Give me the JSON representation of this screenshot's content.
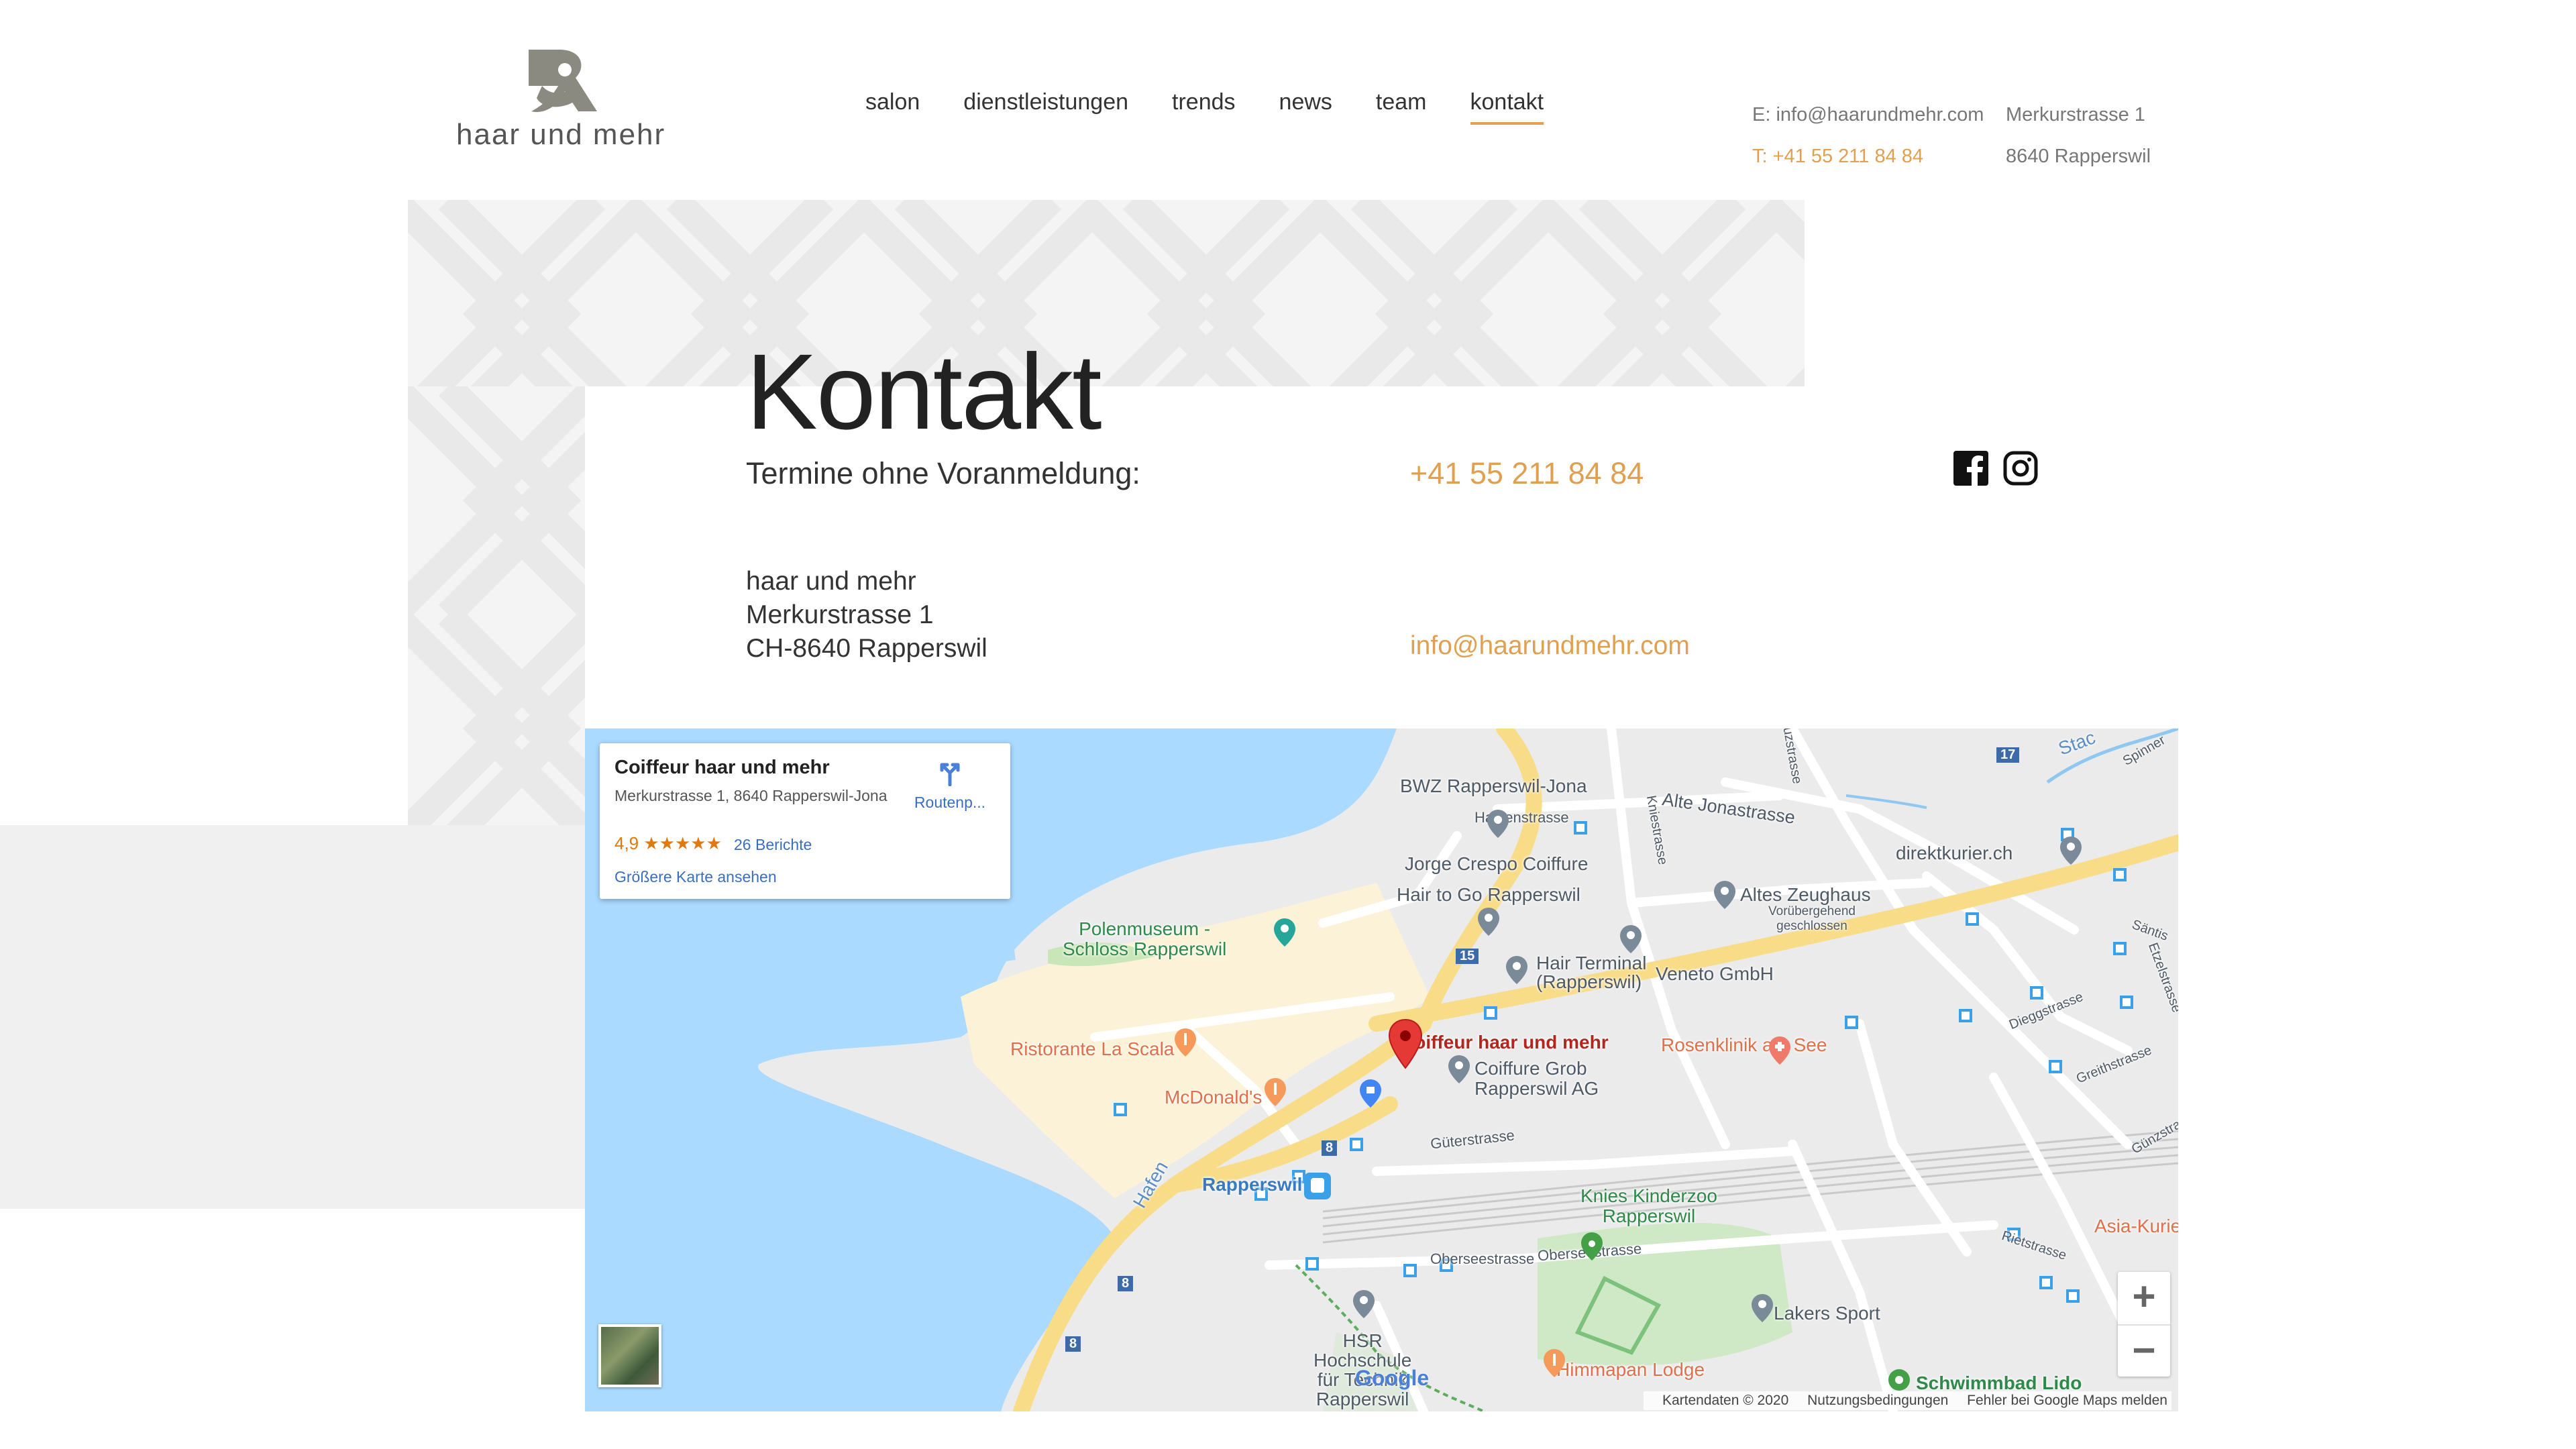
{
  "brand": {
    "logo_text": "haar und mehr"
  },
  "nav": [
    {
      "label": "salon",
      "active": false
    },
    {
      "label": "dienstleistungen",
      "active": false
    },
    {
      "label": "trends",
      "active": false
    },
    {
      "label": "news",
      "active": false
    },
    {
      "label": "team",
      "active": false
    },
    {
      "label": "kontakt",
      "active": true
    }
  ],
  "header_contact": {
    "email": "E: info@haarundmehr.com",
    "phone": "T: +41 55 211 84 84",
    "street": "Merkurstrasse 1",
    "city": "8640 Rapperswil"
  },
  "page": {
    "title": "Kontakt",
    "appointment_label": "Termine ohne Voranmeldung:",
    "phone": "+41 55 211 84 84",
    "address": [
      "haar und mehr",
      "Merkurstrasse 1",
      "CH-8640 Rapperswil"
    ],
    "email": "info@haarundmehr.com"
  },
  "social": [
    "facebook-icon",
    "instagram-icon"
  ],
  "colors": {
    "accent": "#e0a050",
    "water": "#aadaff",
    "road": "#f8dc88"
  },
  "map": {
    "card": {
      "name": "Coiffeur haar und mehr",
      "address": "Merkurstrasse 1, 8640 Rapperswil-Jona",
      "rating": "4,9 ★★★★★",
      "reviews": "26 Berichte",
      "more": "Größere Karte ansehen",
      "route": "Routenp..."
    },
    "labels": {
      "bwz": "BWZ Rapperswil-Jona",
      "haldenstrasse": "Haldenstrasse",
      "jorge": "Jorge Crespo Coiffure",
      "hair_to_go": "Hair to Go Rapperswil",
      "polenmuseum": "Polenmuseum -\nSchloss Rapperswil",
      "hair_terminal": "Hair Terminal\n(Rapperswil)",
      "veneto": "Veneto GmbH",
      "alte_jonastrasse": "Alte Jonastrasse",
      "altes_zeughaus": "Altes Zeughaus",
      "zeughaus_note": "Vorübergehend\ngeschlossen",
      "direktkurier": "direktkurier.ch",
      "scala": "Ristorante La Scala",
      "coiffeur": "Coiffeur haar und mehr",
      "rosenklinik": "Rosenklinik am See",
      "grob": "Coiffure Grob\nRapperswil AG",
      "mcdonalds": "McDonald's",
      "gueterstrasse": "Güterstrasse",
      "rapperswil": "Rapperswil",
      "hafen": "Hafen",
      "knies": "Knies Kinderzoo\nRapperswil",
      "obersee": "Oberseestrasse",
      "obersee2": "Oberseestrasse",
      "hsr": "HSR\nHochschule\nfür Technik\nRapperswil",
      "himmapan": "Himmapan Lodge",
      "lakers": "Lakers Sport",
      "schwimmbad": "Schwimmbad Lido",
      "asia": "Asia-Kurie",
      "dieggstrasse": "Dieggstrasse",
      "greithstrasse": "Greithstrasse",
      "rietstrasse": "Rietstrasse",
      "guenzstrasse": "Günzstrasse",
      "santis": "Säntis",
      "etzelstrasse": "Etzelstrasse",
      "knie": "Kniestrasse",
      "reuzstrasse": "reuzstrasse",
      "spinner": "Spinner",
      "stadt": "Stac"
    },
    "road_numbers": [
      "17",
      "15",
      "8",
      "8",
      "8"
    ],
    "attribution": [
      "Kartendaten © 2020",
      "Nutzungsbedingungen",
      "Fehler bei Google Maps melden"
    ],
    "google": "Google",
    "zoom_in": "+",
    "zoom_out": "−"
  }
}
